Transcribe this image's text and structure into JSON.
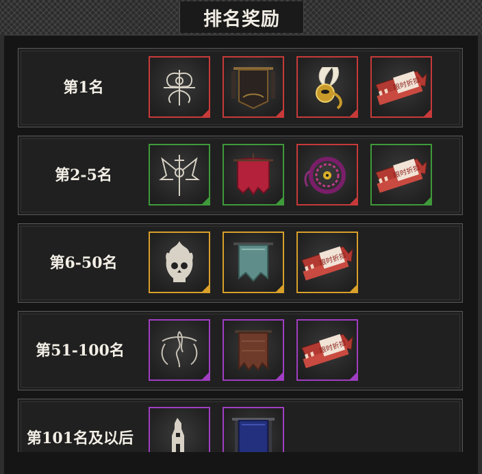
{
  "title": "排名奖励",
  "rarity_colors": {
    "red": "#c83a3a",
    "green": "#3f9a3a",
    "gold": "#d9a02a",
    "purple": "#a03ec2"
  },
  "voucher_text": "限时折扣",
  "tiers": [
    {
      "rank": "第1名",
      "rewards": [
        {
          "icon": "ornate-emblem-icon",
          "rarity": "red"
        },
        {
          "icon": "dark-banner-icon",
          "rarity": "red"
        },
        {
          "icon": "feathered-mask-icon",
          "rarity": "red"
        },
        {
          "icon": "discount-voucher-icon",
          "rarity": "red"
        }
      ]
    },
    {
      "rank": "第2-5名",
      "rewards": [
        {
          "icon": "winged-sword-emblem-icon",
          "rarity": "green"
        },
        {
          "icon": "crimson-banner-icon",
          "rarity": "green"
        },
        {
          "icon": "serpent-eye-emblem-icon",
          "rarity": "red"
        },
        {
          "icon": "discount-voucher-icon",
          "rarity": "green"
        }
      ]
    },
    {
      "rank": "第6-50名",
      "rewards": [
        {
          "icon": "flaming-skull-icon",
          "rarity": "gold"
        },
        {
          "icon": "teal-banner-icon",
          "rarity": "gold"
        },
        {
          "icon": "discount-voucher-icon",
          "rarity": "gold"
        }
      ]
    },
    {
      "rank": "第51-100名",
      "rewards": [
        {
          "icon": "flame-sigil-icon",
          "rarity": "purple"
        },
        {
          "icon": "brown-banner-icon",
          "rarity": "purple"
        },
        {
          "icon": "discount-voucher-icon",
          "rarity": "purple"
        }
      ]
    },
    {
      "rank": "第101名及以后",
      "rewards": [
        {
          "icon": "tower-emblem-icon",
          "rarity": "purple"
        },
        {
          "icon": "blue-banner-icon",
          "rarity": "purple"
        }
      ]
    }
  ]
}
